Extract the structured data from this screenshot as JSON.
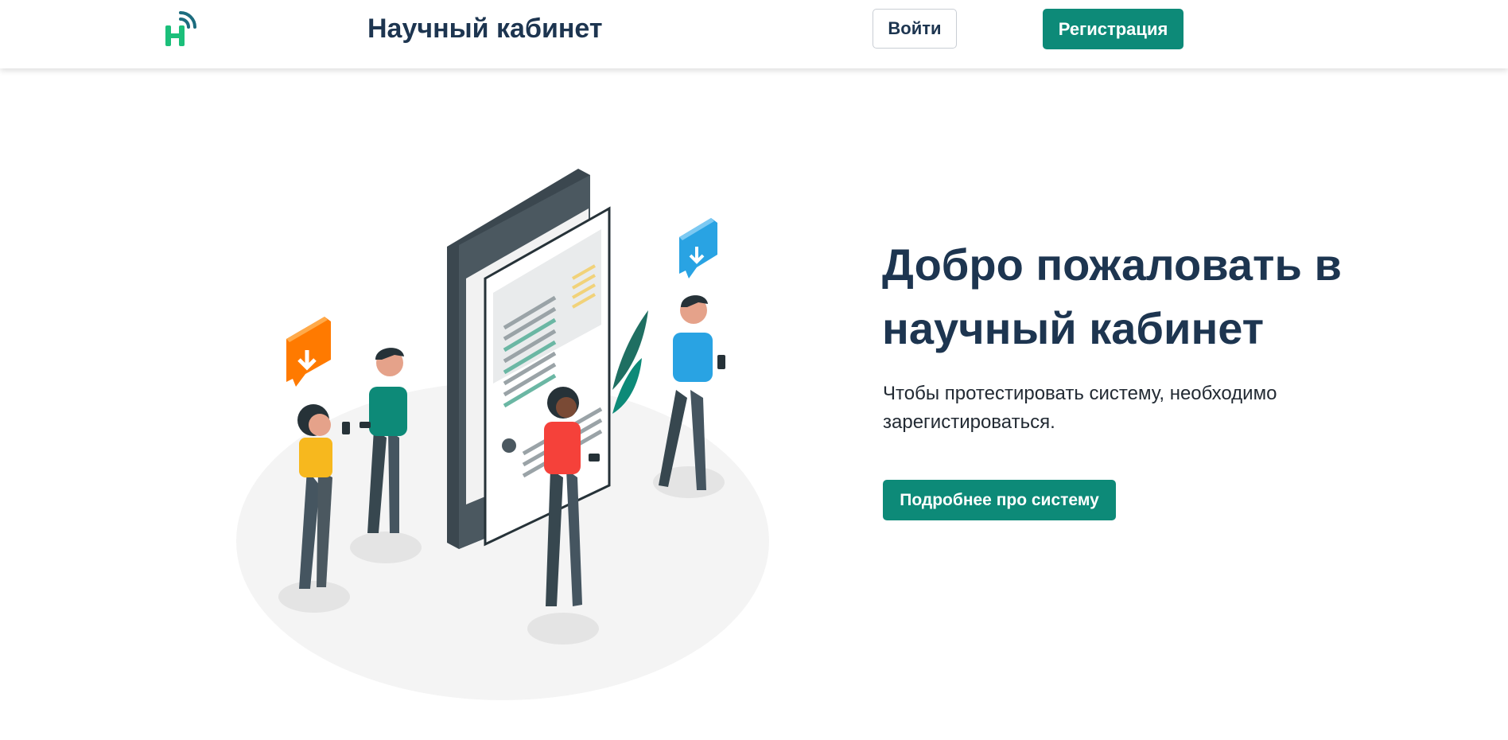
{
  "header": {
    "logo_icon": "signal-h-logo-icon",
    "title": "Научный кабинет",
    "login_label": "Войти",
    "register_label": "Регистрация"
  },
  "hero": {
    "title": "Добро пожаловать в научный кабинет",
    "description": "Чтобы протестировать систему, необходимо зарегистироваться.",
    "button_label": "Подробнее про систему"
  },
  "colors": {
    "primary": "#0d8a78",
    "heading": "#1d3550",
    "logo_green": "#1bbf7a",
    "logo_teal": "#1c6c7e"
  }
}
